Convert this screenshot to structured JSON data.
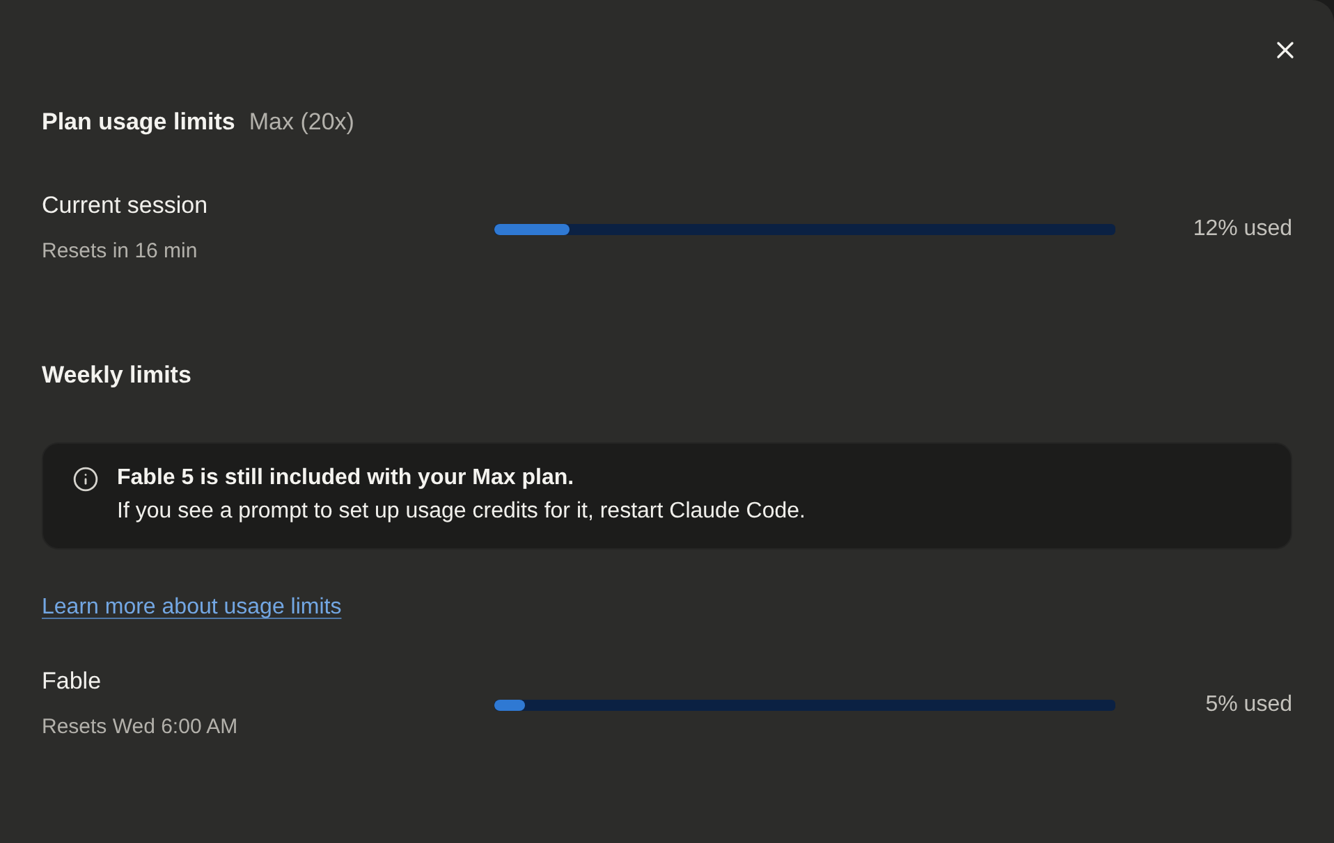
{
  "header": {
    "title": "Plan usage limits",
    "plan": "Max (20x)"
  },
  "session": {
    "name": "Current session",
    "resets": "Resets in 16 min",
    "level": 0.12,
    "reading": "12% used"
  },
  "weekly": {
    "title": "Weekly limits",
    "notice": {
      "heading": "Fable 5 is still included with your Max plan.",
      "body": "If you see a prompt to set up usage credits for it, restart Claude Code."
    },
    "link": "Learn more about usage limits",
    "limits": [
      {
        "name": "Fable",
        "resets": "Resets Wed 6:00 AM",
        "level": 0.05,
        "reading": "5% used"
      }
    ]
  }
}
